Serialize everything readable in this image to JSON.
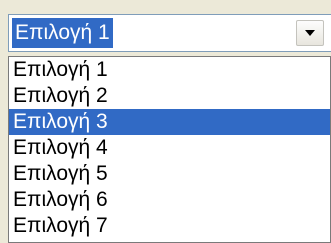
{
  "combo": {
    "value": "Επιλογή 1",
    "button_icon": "chevron-down-icon"
  },
  "dropdown": {
    "options": [
      {
        "label": "Επιλογή 1"
      },
      {
        "label": "Επιλογή 2"
      },
      {
        "label": "Επιλογή 3",
        "selected": true
      },
      {
        "label": "Επιλογή 4"
      },
      {
        "label": "Επιλογή 5"
      },
      {
        "label": "Επιλογή 6"
      },
      {
        "label": "Επιλογή 7"
      }
    ]
  },
  "colors": {
    "selection": "#316ac5",
    "background": "#ece9d8",
    "list_background": "#ffffff"
  }
}
